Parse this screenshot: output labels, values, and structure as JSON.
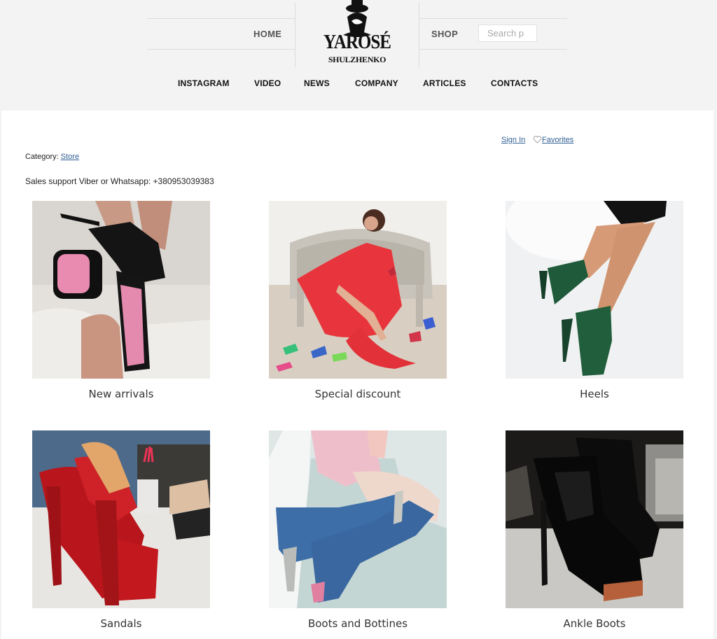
{
  "header": {
    "home_label": "HOME",
    "shop_label": "SHOP",
    "search_placeholder": "Search p",
    "logo_line1": "YAROSÉ",
    "logo_line2": "SHULZHENKO",
    "nav": [
      {
        "label": "INSTAGRAM"
      },
      {
        "label": "VIDEO"
      },
      {
        "label": "NEWS"
      },
      {
        "label": "COMPANY"
      },
      {
        "label": "ARTICLES"
      },
      {
        "label": "CONTACTS"
      }
    ]
  },
  "account": {
    "sign_in": "Sign In",
    "favorites": "Favorites"
  },
  "category": {
    "prefix": "Category:",
    "link": "Store"
  },
  "sales_support": "Sales support Viber or Whatsapp: +380953039383",
  "categories": [
    {
      "label": "New arrivals",
      "icon": "pink-sole-platform-boots-photo"
    },
    {
      "label": "Special discount",
      "icon": "woman-red-dress-sofa-photo"
    },
    {
      "label": "Heels",
      "icon": "green-platform-heels-photo"
    },
    {
      "label": "Sandals",
      "icon": "red-platform-sandals-photo"
    },
    {
      "label": "Boots and Bottines",
      "icon": "blue-suede-boots-photo"
    },
    {
      "label": "Ankle Boots",
      "icon": "black-patent-ankle-boots-photo"
    }
  ],
  "colors": {
    "link": "#2f5f93",
    "page_bg": "#f3f3f3",
    "panel_bg": "#ffffff"
  }
}
